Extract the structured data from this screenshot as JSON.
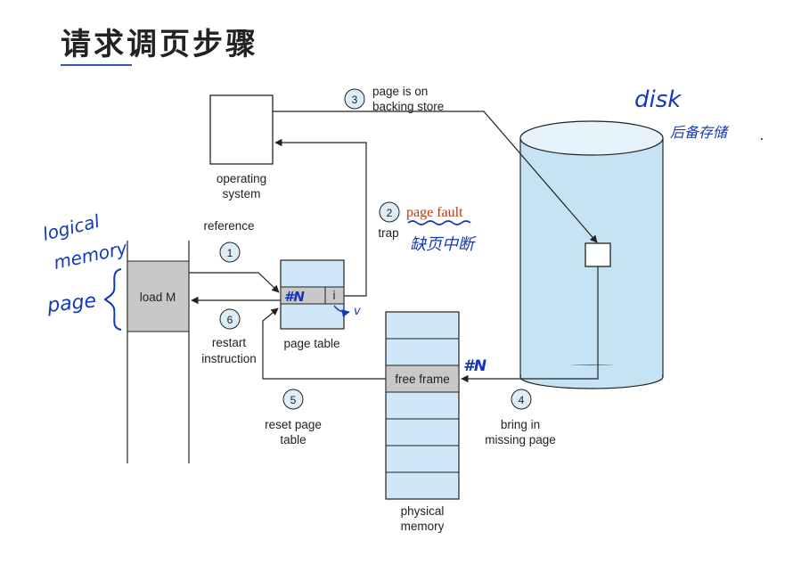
{
  "title": "请求调页步骤",
  "steps": {
    "s1": {
      "num": "1",
      "label": "reference"
    },
    "s2": {
      "num": "2",
      "label": "trap"
    },
    "s3": {
      "num": "3",
      "label_line1": "page is on",
      "label_line2": "backing store"
    },
    "s4": {
      "num": "4",
      "label_line1": "bring in",
      "label_line2": "missing page"
    },
    "s5": {
      "num": "5",
      "label_line1": "reset page",
      "label_line2": "table"
    },
    "s6": {
      "num": "6",
      "label_line1": "restart",
      "label_line2": "instruction"
    }
  },
  "blocks": {
    "os_line1": "operating",
    "os_line2": "system",
    "load": "load M",
    "page_table": "page table",
    "pt_entry_bit": "i",
    "free_frame": "free frame",
    "phys_line1": "physical",
    "phys_line2": "memory"
  },
  "annotations": {
    "disk": "disk",
    "disk_cn": "后备存储",
    "page_fault": "page fault",
    "page_fault_cn": "缺页中断",
    "logical": "logical",
    "memory": "memory",
    "page": "page",
    "frame_no": "#N",
    "entry_no": "#N",
    "valid_mark": "v"
  },
  "colors": {
    "ink": "#222222",
    "annotation_blue": "#1438b8",
    "annotation_red": "#b23a1e",
    "disk_fill": "#c6e2f5",
    "table_fill": "#cfe7f7",
    "gray_fill": "#c8c8c8",
    "step_fill": "#dbeef9",
    "accent": "#2a5db8"
  }
}
